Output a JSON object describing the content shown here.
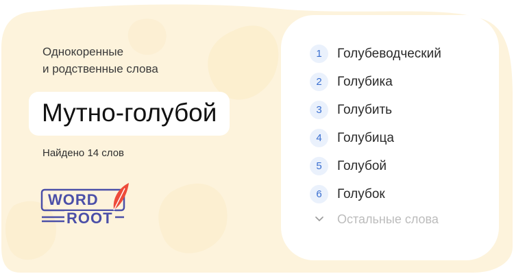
{
  "header": {
    "heading_line1": "Однокоренные",
    "heading_line2": "и родственные слова"
  },
  "main": {
    "word": "Мутно-голубой",
    "found_count": "Найдено 14 слов"
  },
  "logo": {
    "line1": "WORD",
    "line2": "ROOT",
    "icon": "feather-icon"
  },
  "list": {
    "items": [
      {
        "num": "1",
        "text": "Голубеводческий"
      },
      {
        "num": "2",
        "text": "Голубика"
      },
      {
        "num": "3",
        "text": "Голубить"
      },
      {
        "num": "4",
        "text": "Голубица"
      },
      {
        "num": "5",
        "text": "Голубой"
      },
      {
        "num": "6",
        "text": "Голубок"
      }
    ],
    "more_label": "Остальные слова",
    "more_icon": "chevron-down-icon"
  },
  "colors": {
    "background_warm": "#fdf3dc",
    "accent_blue": "#3a6fd0",
    "badge_bg": "#eaf1fc",
    "logo_purple": "#4b4fa8",
    "feather_red": "#ee4b3a"
  }
}
